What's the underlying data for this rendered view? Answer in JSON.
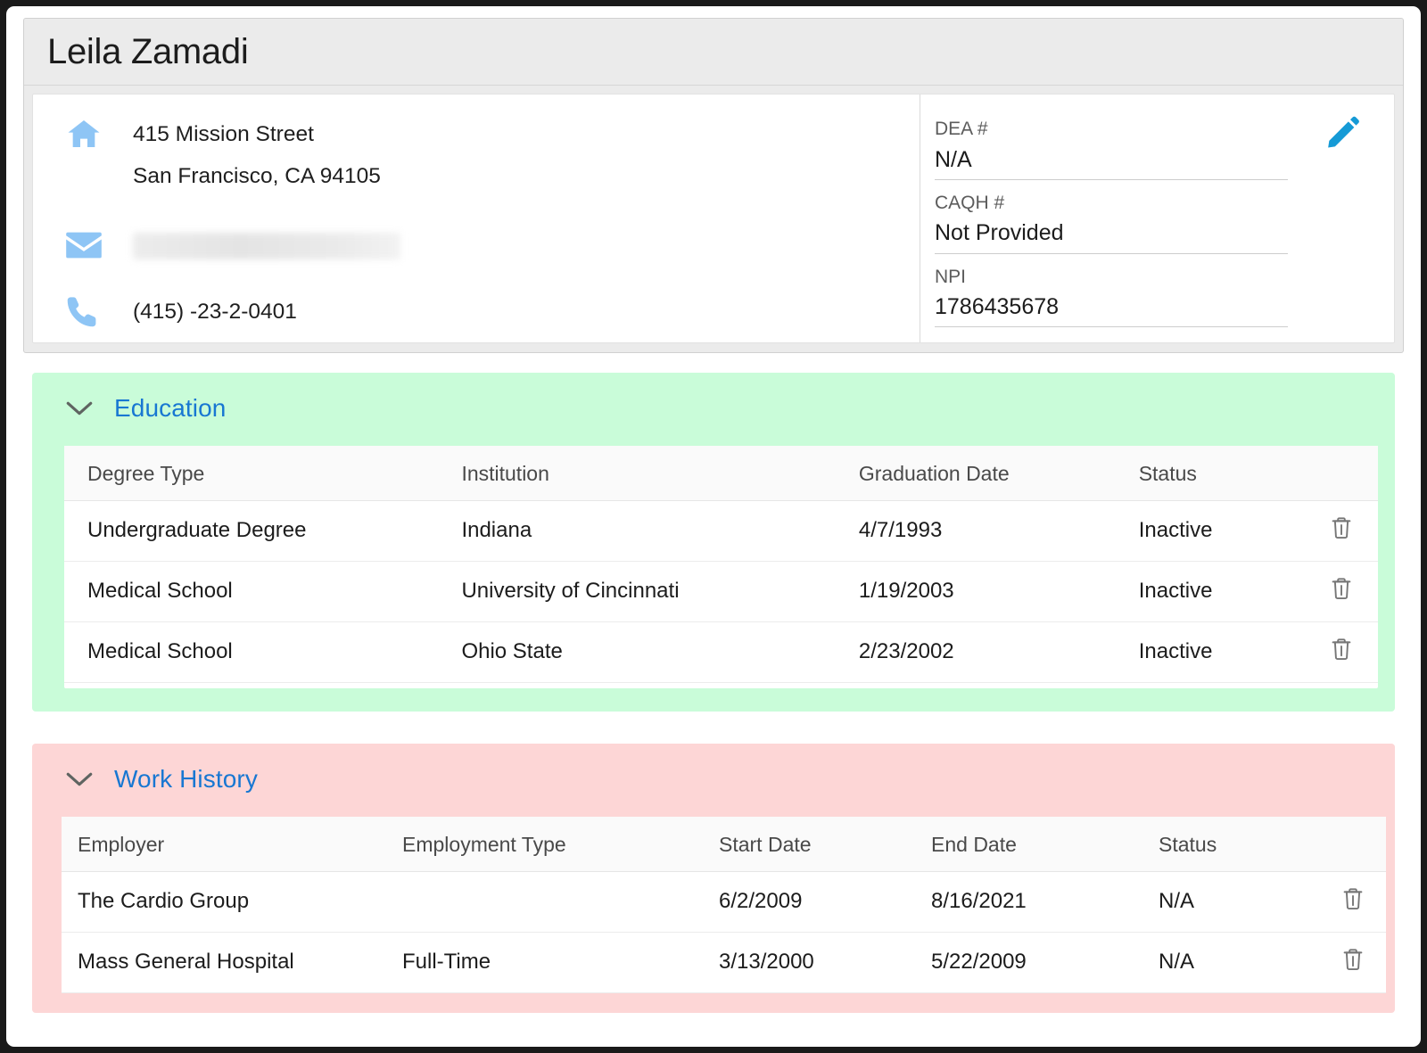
{
  "profile": {
    "name": "Leila Zamadi",
    "contact": {
      "home_icon": "home-icon",
      "address_line1": "415 Mission Street",
      "address_line2": "San Francisco, CA 94105",
      "email_icon": "mail-icon",
      "email": "",
      "phone_icon": "phone-icon",
      "phone": "(415) -23-2-0401"
    },
    "credentials": [
      {
        "label": "DEA #",
        "value": "N/A"
      },
      {
        "label": "CAQH #",
        "value": "Not Provided"
      },
      {
        "label": "NPI",
        "value": "1786435678"
      }
    ],
    "edit_icon": "pencil-icon"
  },
  "education": {
    "title": "Education",
    "chevron_icon": "chevron-down-icon",
    "background_color": "#c9fcd9",
    "columns": [
      "Degree Type",
      "Institution",
      "Graduation Date",
      "Status",
      ""
    ],
    "rows": [
      {
        "degree_type": "Undergraduate Degree",
        "institution": "Indiana",
        "graduation_date": "4/7/1993",
        "status": "Inactive",
        "delete_icon": "trash-icon"
      },
      {
        "degree_type": "Medical School",
        "institution": "University of Cincinnati",
        "graduation_date": "1/19/2003",
        "status": "Inactive",
        "delete_icon": "trash-icon"
      },
      {
        "degree_type": "Medical School",
        "institution": "Ohio State",
        "graduation_date": "2/23/2002",
        "status": "Inactive",
        "delete_icon": "trash-icon"
      }
    ]
  },
  "work_history": {
    "title": "Work History",
    "chevron_icon": "chevron-down-icon",
    "background_color": "#fdd6d6",
    "columns": [
      "Employer",
      "Employment Type",
      "Start Date",
      "End Date",
      "Status",
      ""
    ],
    "rows": [
      {
        "employer": "The Cardio Group",
        "employment_type": "",
        "start_date": "6/2/2009",
        "end_date": "8/16/2021",
        "status": "N/A",
        "delete_icon": "trash-icon"
      },
      {
        "employer": "Mass General Hospital",
        "employment_type": "Full-Time",
        "start_date": "3/13/2000",
        "end_date": "5/22/2009",
        "status": "N/A",
        "delete_icon": "trash-icon"
      }
    ]
  },
  "colors": {
    "link": "#1877d2",
    "icon_blue": "#8ec5f5",
    "pencil_blue": "#159ad6"
  }
}
